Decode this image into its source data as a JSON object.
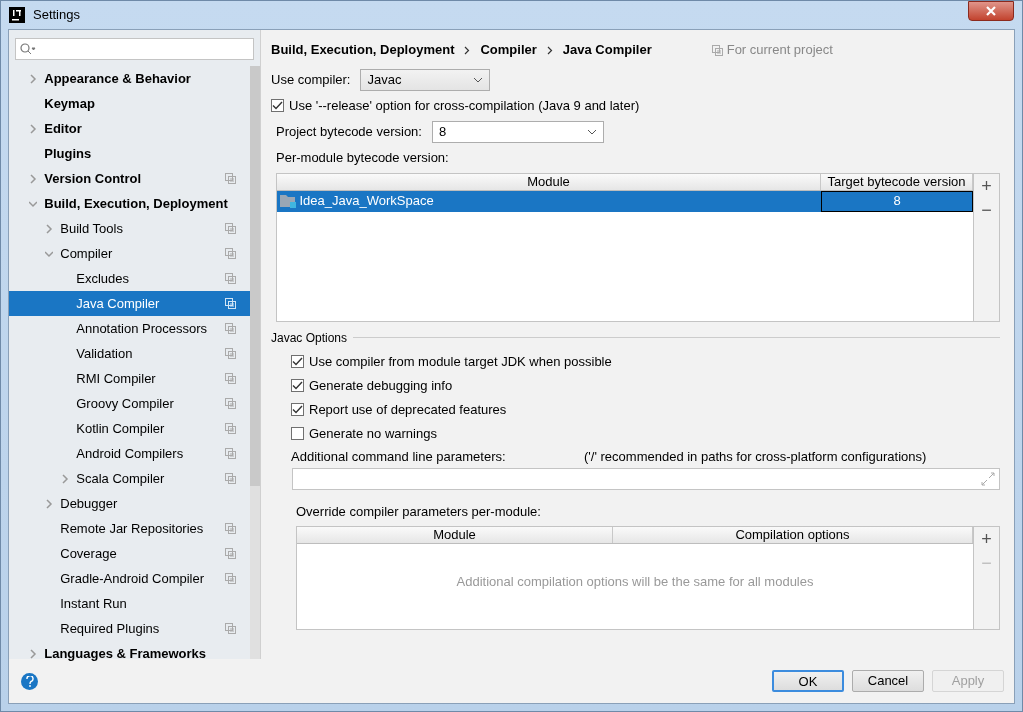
{
  "window": {
    "title": "Settings"
  },
  "sidebar": {
    "items": [
      {
        "label": "Appearance & Behavior",
        "expanded": false,
        "project_scoped": false,
        "selected": false
      },
      {
        "label": "Keymap",
        "project_scoped": false,
        "selected": false
      },
      {
        "label": "Editor",
        "expanded": false,
        "project_scoped": false,
        "selected": false
      },
      {
        "label": "Plugins",
        "project_scoped": false,
        "selected": false
      },
      {
        "label": "Version Control",
        "expanded": false,
        "project_scoped": true,
        "selected": false
      },
      {
        "label": "Build, Execution, Deployment",
        "expanded": true,
        "project_scoped": false,
        "selected": false,
        "children": [
          {
            "label": "Build Tools",
            "expanded": false,
            "project_scoped": true,
            "selected": false
          },
          {
            "label": "Compiler",
            "expanded": true,
            "project_scoped": true,
            "selected": false,
            "children": [
              {
                "label": "Excludes",
                "project_scoped": true,
                "selected": false
              },
              {
                "label": "Java Compiler",
                "project_scoped": true,
                "selected": true
              },
              {
                "label": "Annotation Processors",
                "project_scoped": true,
                "selected": false
              },
              {
                "label": "Validation",
                "project_scoped": true,
                "selected": false
              },
              {
                "label": "RMI Compiler",
                "project_scoped": true,
                "selected": false
              },
              {
                "label": "Groovy Compiler",
                "project_scoped": true,
                "selected": false
              },
              {
                "label": "Kotlin Compiler",
                "project_scoped": true,
                "selected": false
              },
              {
                "label": "Android Compilers",
                "project_scoped": true,
                "selected": false
              },
              {
                "label": "Scala Compiler",
                "expanded": false,
                "project_scoped": true,
                "selected": false
              }
            ]
          },
          {
            "label": "Debugger",
            "expanded": false,
            "project_scoped": false,
            "selected": false
          },
          {
            "label": "Remote Jar Repositories",
            "project_scoped": true,
            "selected": false
          },
          {
            "label": "Coverage",
            "project_scoped": true,
            "selected": false
          },
          {
            "label": "Gradle-Android Compiler",
            "project_scoped": true,
            "selected": false
          },
          {
            "label": "Instant Run",
            "project_scoped": false,
            "selected": false
          },
          {
            "label": "Required Plugins",
            "project_scoped": true,
            "selected": false
          }
        ]
      },
      {
        "label": "Languages & Frameworks",
        "expanded": false,
        "project_scoped": false,
        "selected": false
      }
    ]
  },
  "breadcrumb": [
    "Build, Execution, Deployment",
    "Compiler",
    "Java Compiler"
  ],
  "scope_note": "For current project",
  "use_compiler": {
    "label": "Use compiler:",
    "value": "Javac"
  },
  "release_option": {
    "label": "Use '--release' option for cross-compilation (Java 9 and later)",
    "checked": true
  },
  "project_bytecode": {
    "label": "Project bytecode version:",
    "value": "8"
  },
  "per_module": {
    "label": "Per-module bytecode version:",
    "columns": [
      "Module",
      "Target bytecode version"
    ],
    "rows": [
      {
        "module": "Idea_Java_WorkSpace",
        "target": "8",
        "selected": true
      }
    ],
    "tools": [
      {
        "label": "+",
        "disabled": false
      },
      {
        "label": "−",
        "disabled": false
      }
    ]
  },
  "javac_options": {
    "title": "Javac Options",
    "options": [
      {
        "label": "Use compiler from module target JDK when possible",
        "checked": true
      },
      {
        "label": "Generate debugging info",
        "checked": true
      },
      {
        "label": "Report use of deprecated features",
        "checked": true
      },
      {
        "label": "Generate no warnings",
        "checked": false
      }
    ],
    "params_label": "Additional command line parameters:",
    "params_hint": "('/' recommended in paths for cross-platform configurations)"
  },
  "override": {
    "label": "Override compiler parameters per-module:",
    "columns": [
      "Module",
      "Compilation options"
    ],
    "empty_text": "Additional compilation options will be the same for all modules",
    "tools": [
      {
        "label": "+",
        "disabled": false
      },
      {
        "label": "−",
        "disabled": true
      }
    ]
  },
  "buttons": [
    {
      "label": "OK",
      "kind": "default",
      "disabled": false
    },
    {
      "label": "Cancel",
      "kind": "normal",
      "disabled": false
    },
    {
      "label": "Apply",
      "kind": "normal",
      "disabled": true
    }
  ]
}
